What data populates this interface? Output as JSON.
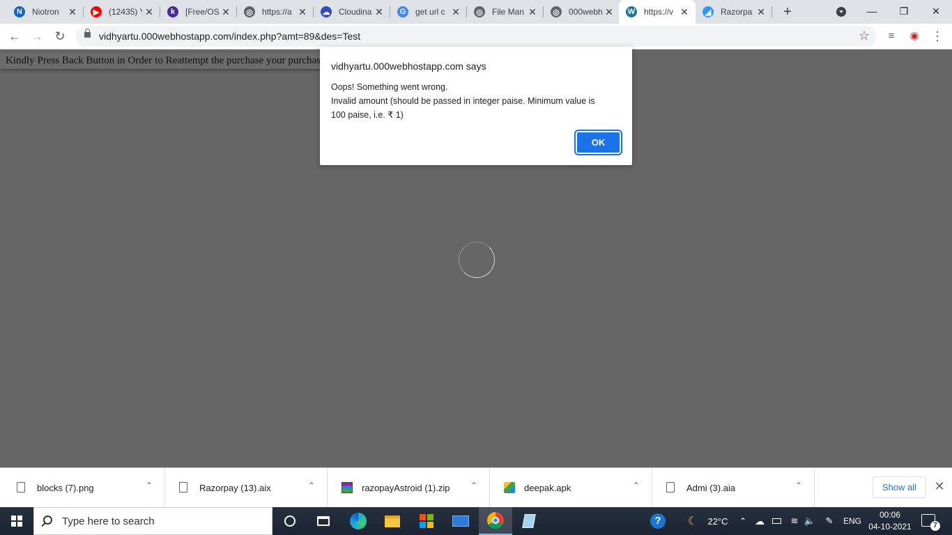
{
  "browser": {
    "tabs": [
      {
        "title": "Niotron",
        "icon": "niotron-icon",
        "color": "#1565c0",
        "letter": "N"
      },
      {
        "title": "(12435) Y",
        "icon": "youtube-icon",
        "color": "#ff0000",
        "letter": "▶"
      },
      {
        "title": "[Free/OS",
        "icon": "kodular-icon",
        "color": "#4527a0",
        "letter": "k"
      },
      {
        "title": "https://a",
        "icon": "globe-icon",
        "color": "#5f6368",
        "letter": "◎"
      },
      {
        "title": "Cloudina",
        "icon": "cloudinary-icon",
        "color": "#3448c5",
        "letter": "☁"
      },
      {
        "title": "get url c",
        "icon": "google-icon",
        "color": "#4285f4",
        "letter": "G"
      },
      {
        "title": "File Man",
        "icon": "globe-icon",
        "color": "#5f6368",
        "letter": "◎"
      },
      {
        "title": "000webh",
        "icon": "globe-icon",
        "color": "#5f6368",
        "letter": "◎"
      },
      {
        "title": "https://v",
        "icon": "wordpress-icon",
        "color": "#21759b",
        "letter": "W"
      },
      {
        "title": "Razorpa",
        "icon": "razorpay-icon",
        "color": "#3395ff",
        "letter": "◢"
      }
    ],
    "active_tab": 8,
    "url": "vidhyartu.000webhostapp.com/index.php?amt=89&des=Test"
  },
  "page": {
    "message": "Kindly Press Back Button in Order to Reattempt the purchase your purchase"
  },
  "dialog": {
    "title": "vidhyartu.000webhostapp.com says",
    "line1": "Oops! Something went wrong.",
    "line2": "Invalid amount (should be passed in integer paise. Minimum value is",
    "line3": "100 paise, i.e. ₹ 1)",
    "ok_label": "OK"
  },
  "downloads": {
    "items": [
      {
        "name": "blocks (7).png",
        "icon": "png-file-icon"
      },
      {
        "name": "Razorpay (13).aix",
        "icon": "file-icon"
      },
      {
        "name": "razopayAstroid (1).zip",
        "icon": "winrar-icon"
      },
      {
        "name": "deepak.apk",
        "icon": "bluestacks-icon"
      },
      {
        "name": "Admi (3).aia",
        "icon": "file-icon"
      }
    ],
    "show_all_label": "Show all"
  },
  "taskbar": {
    "search_placeholder": "Type here to search",
    "temperature": "22°C",
    "language": "ENG",
    "time": "00:06",
    "date": "04-10-2021",
    "notification_count": "7"
  }
}
